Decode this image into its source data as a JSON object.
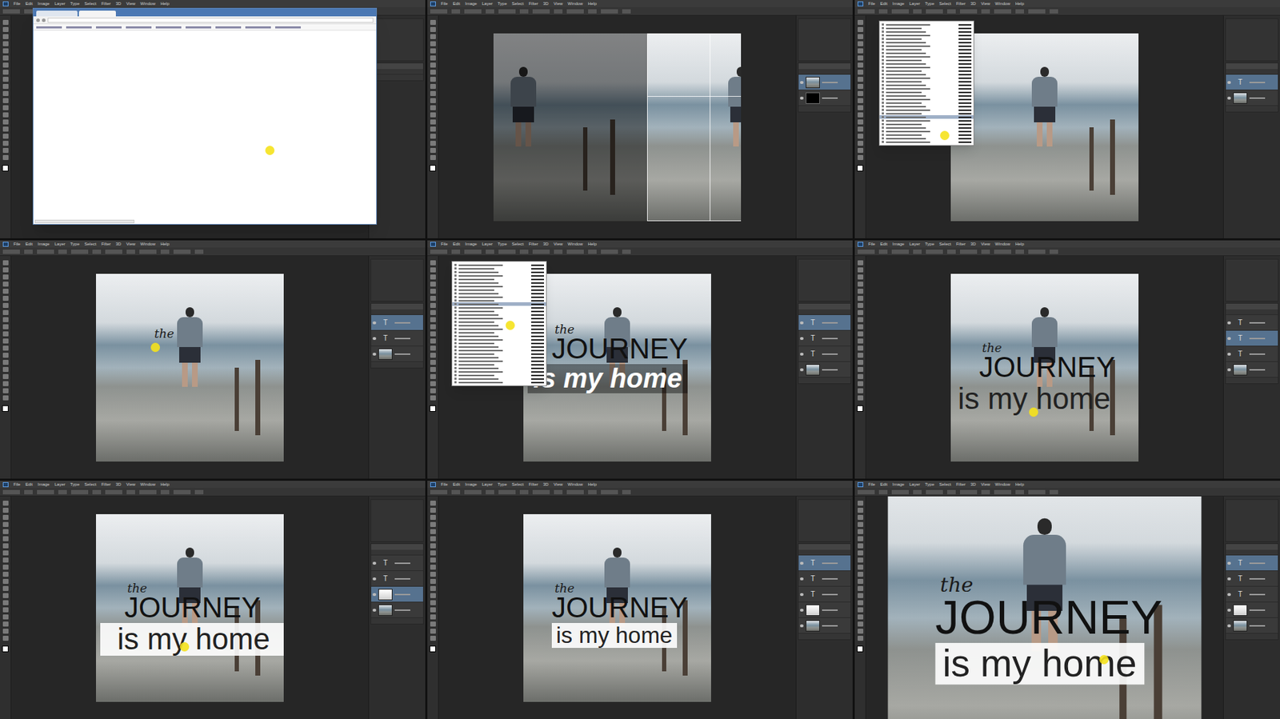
{
  "menu": [
    "File",
    "Edit",
    "Image",
    "Layer",
    "Type",
    "Select",
    "Filter",
    "3D",
    "View",
    "Window",
    "Help"
  ],
  "panels": [
    {
      "kind": "browser",
      "cursor": true,
      "font_menu": false,
      "band": "none",
      "texts": [],
      "layers": []
    },
    {
      "kind": "crop",
      "cursor": false,
      "font_menu": false,
      "band": "none",
      "texts": [],
      "layers": [
        {
          "kind": "image",
          "selected": true
        },
        {
          "kind": "mask",
          "selected": false
        }
      ]
    },
    {
      "kind": "canvas",
      "cursor": true,
      "font_menu": true,
      "band": "none",
      "texts": [],
      "layers": [
        {
          "kind": "text",
          "thumb": "T",
          "selected": true
        },
        {
          "kind": "image",
          "selected": false
        }
      ]
    },
    {
      "kind": "canvas",
      "cursor": true,
      "font_menu": false,
      "band": "none",
      "texts": [
        {
          "kind": "small",
          "text": "the"
        }
      ],
      "layers": [
        {
          "kind": "text",
          "thumb": "T",
          "selected": true
        },
        {
          "kind": "text",
          "thumb": "T",
          "selected": false
        },
        {
          "kind": "image",
          "selected": false
        }
      ]
    },
    {
      "kind": "canvas",
      "cursor": true,
      "font_menu": true,
      "band": "dark",
      "texts": [
        {
          "kind": "small",
          "text": "the"
        },
        {
          "kind": "title",
          "text": "JOURNEY"
        },
        {
          "kind": "line",
          "text": "is my home"
        }
      ],
      "layers": [
        {
          "kind": "text",
          "thumb": "T",
          "selected": true
        },
        {
          "kind": "text",
          "thumb": "T",
          "selected": false
        },
        {
          "kind": "text",
          "thumb": "T",
          "selected": false
        },
        {
          "kind": "image",
          "selected": false
        }
      ]
    },
    {
      "kind": "canvas",
      "cursor": true,
      "font_menu": false,
      "band": "none",
      "texts": [
        {
          "kind": "small",
          "text": "the"
        },
        {
          "kind": "title",
          "text": "JOURNEY"
        },
        {
          "kind": "line",
          "text": "is my home"
        }
      ],
      "layers": [
        {
          "kind": "text",
          "thumb": "T",
          "selected": false
        },
        {
          "kind": "text",
          "thumb": "T",
          "selected": true
        },
        {
          "kind": "text",
          "thumb": "T",
          "selected": false
        },
        {
          "kind": "image",
          "selected": false
        }
      ]
    },
    {
      "kind": "canvas",
      "cursor": true,
      "font_menu": false,
      "band": "wide",
      "texts": [
        {
          "kind": "small",
          "text": "the"
        },
        {
          "kind": "title",
          "text": "JOURNEY"
        },
        {
          "kind": "line",
          "text": "is my home"
        }
      ],
      "layers": [
        {
          "kind": "text",
          "thumb": "T",
          "selected": false
        },
        {
          "kind": "text",
          "thumb": "T",
          "selected": false
        },
        {
          "kind": "fill",
          "selected": true
        },
        {
          "kind": "image",
          "selected": false
        }
      ]
    },
    {
      "kind": "canvas",
      "cursor": false,
      "font_menu": false,
      "band": "narrow",
      "texts": [
        {
          "kind": "small",
          "text": "the"
        },
        {
          "kind": "title",
          "text": "JOURNEY"
        },
        {
          "kind": "line",
          "text": "is my home"
        }
      ],
      "layers": [
        {
          "kind": "text",
          "thumb": "T",
          "selected": true
        },
        {
          "kind": "text",
          "thumb": "T",
          "selected": false
        },
        {
          "kind": "text",
          "thumb": "T",
          "selected": false
        },
        {
          "kind": "fill",
          "selected": false
        },
        {
          "kind": "image",
          "selected": false
        }
      ]
    },
    {
      "kind": "zoom",
      "cursor": true,
      "font_menu": false,
      "band": "narrow",
      "texts": [
        {
          "kind": "small",
          "text": "the"
        },
        {
          "kind": "title",
          "text": "JOURNEY"
        },
        {
          "kind": "line",
          "text": "is my home"
        }
      ],
      "layers": [
        {
          "kind": "text",
          "thumb": "T",
          "selected": true
        },
        {
          "kind": "text",
          "thumb": "T",
          "selected": false
        },
        {
          "kind": "text",
          "thumb": "T",
          "selected": false
        },
        {
          "kind": "fill",
          "selected": false
        },
        {
          "kind": "image",
          "selected": false
        }
      ]
    }
  ]
}
